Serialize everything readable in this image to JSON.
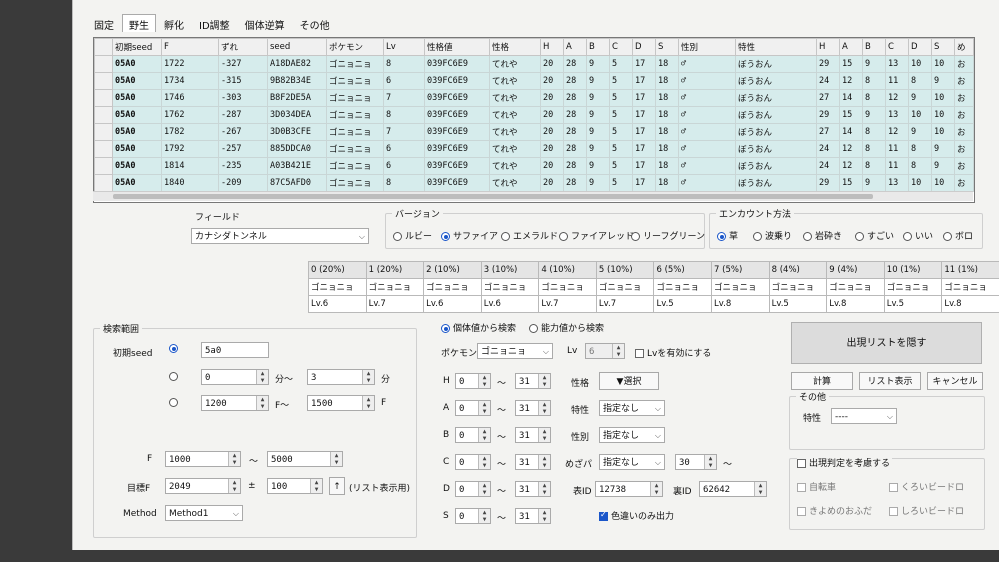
{
  "tabs": [
    "固定",
    "野生",
    "孵化",
    "ID調整",
    "個体逆算",
    "その他"
  ],
  "active_tab": 1,
  "results": {
    "columns": [
      "初期seed",
      "F",
      "ずれ",
      "seed",
      "ポケモン",
      "Lv",
      "性格値",
      "性格",
      "H",
      "A",
      "B",
      "C",
      "D",
      "S",
      "性別",
      "特性",
      "H",
      "A",
      "B",
      "C",
      "D",
      "S",
      "め"
    ],
    "rows": [
      [
        "05A0",
        "1722",
        "-327",
        "A18DAE82",
        "ゴニョニョ",
        "8",
        "039FC6E9",
        "てれや",
        "20",
        "28",
        "9",
        "5",
        "17",
        "18",
        "♂",
        "ぼうおん",
        "29",
        "15",
        "9",
        "13",
        "10",
        "10",
        "お"
      ],
      [
        "05A0",
        "1734",
        "-315",
        "9B82B34E",
        "ゴニョニョ",
        "6",
        "039FC6E9",
        "てれや",
        "20",
        "28",
        "9",
        "5",
        "17",
        "18",
        "♂",
        "ぼうおん",
        "24",
        "12",
        "8",
        "11",
        "8",
        "9",
        "お"
      ],
      [
        "05A0",
        "1746",
        "-303",
        "B8F2DE5A",
        "ゴニョニョ",
        "7",
        "039FC6E9",
        "てれや",
        "20",
        "28",
        "9",
        "5",
        "17",
        "18",
        "♂",
        "ぼうおん",
        "27",
        "14",
        "8",
        "12",
        "9",
        "10",
        "お"
      ],
      [
        "05A0",
        "1762",
        "-287",
        "3D034DEA",
        "ゴニョニョ",
        "8",
        "039FC6E9",
        "てれや",
        "20",
        "28",
        "9",
        "5",
        "17",
        "18",
        "♂",
        "ぼうおん",
        "29",
        "15",
        "9",
        "13",
        "10",
        "10",
        "お"
      ],
      [
        "05A0",
        "1782",
        "-267",
        "3D0B3CFE",
        "ゴニョニョ",
        "7",
        "039FC6E9",
        "てれや",
        "20",
        "28",
        "9",
        "5",
        "17",
        "18",
        "♂",
        "ぼうおん",
        "27",
        "14",
        "8",
        "12",
        "9",
        "10",
        "お"
      ],
      [
        "05A0",
        "1792",
        "-257",
        "885DDCA0",
        "ゴニョニョ",
        "6",
        "039FC6E9",
        "てれや",
        "20",
        "28",
        "9",
        "5",
        "17",
        "18",
        "♂",
        "ぼうおん",
        "24",
        "12",
        "8",
        "11",
        "8",
        "9",
        "お"
      ],
      [
        "05A0",
        "1814",
        "-235",
        "A03B421E",
        "ゴニョニョ",
        "6",
        "039FC6E9",
        "てれや",
        "20",
        "28",
        "9",
        "5",
        "17",
        "18",
        "♂",
        "ぼうおん",
        "24",
        "12",
        "8",
        "11",
        "8",
        "9",
        "お"
      ],
      [
        "05A0",
        "1840",
        "-209",
        "87C5AFD0",
        "ゴニョニョ",
        "8",
        "039FC6E9",
        "てれや",
        "20",
        "28",
        "9",
        "5",
        "17",
        "18",
        "♂",
        "ぼうおん",
        "29",
        "15",
        "9",
        "13",
        "10",
        "10",
        "お"
      ]
    ]
  },
  "field": {
    "legend": "フィールド",
    "value": "カナシダトンネル"
  },
  "version": {
    "legend": "バージョン",
    "options": [
      "ルビー",
      "サファイア",
      "エメラルド",
      "ファイアレッド",
      "リーフグリーン"
    ],
    "selected": 1
  },
  "encounter": {
    "legend": "エンカウント方法",
    "options": [
      "草",
      "波乗り",
      "岩砕き",
      "すごい",
      "いい",
      "ボロ"
    ],
    "selected": 0
  },
  "slots": {
    "headers": [
      "0 (20%)",
      "1 (20%)",
      "2 (10%)",
      "3 (10%)",
      "4 (10%)",
      "5 (10%)",
      "6 (5%)",
      "7 (5%)",
      "8 (4%)",
      "9 (4%)",
      "10 (1%)",
      "11 (1%)"
    ],
    "pokemon": [
      "ゴニョニョ",
      "ゴニョニョ",
      "ゴニョニョ",
      "ゴニョニョ",
      "ゴニョニョ",
      "ゴニョニョ",
      "ゴニョニョ",
      "ゴニョニョ",
      "ゴニョニョ",
      "ゴニョニョ",
      "ゴニョニョ",
      "ゴニョニョ"
    ],
    "levels": [
      "Lv.6",
      "Lv.7",
      "Lv.6",
      "Lv.6",
      "Lv.7",
      "Lv.7",
      "Lv.5",
      "Lv.8",
      "Lv.5",
      "Lv.8",
      "Lv.5",
      "Lv.8"
    ]
  },
  "search_range": {
    "legend": "検索範囲",
    "initial_seed_label": "初期seed",
    "initial_seed": "5a0",
    "min_from": "0",
    "min_to": "3",
    "min_sep": "分～",
    "min_unit": "分",
    "f_from": "1200",
    "f_to": "1500",
    "f_sep": "F～",
    "f_unit": "F",
    "f_label": "F",
    "f_min": "1000",
    "f_max": "5000",
    "tilde": "～",
    "target_label": "目標F",
    "target": "2049",
    "pm": "±",
    "range": "100",
    "up": "↑",
    "list_note": "(リスト表示用)",
    "method_label": "Method",
    "method": "Method1"
  },
  "iv_search": {
    "mode_iv": "個体値から検索",
    "mode_stat": "能力値から検索",
    "pokemon_label": "ポケモン",
    "pokemon": "ゴニョニョ",
    "lv_label": "Lv",
    "lv": "6",
    "lv_enable": "Lvを有効にする",
    "stats": [
      {
        "label": "H",
        "min": "0",
        "max": "31"
      },
      {
        "label": "A",
        "min": "0",
        "max": "31"
      },
      {
        "label": "B",
        "min": "0",
        "max": "31"
      },
      {
        "label": "C",
        "min": "0",
        "max": "31"
      },
      {
        "label": "D",
        "min": "0",
        "max": "31"
      },
      {
        "label": "S",
        "min": "0",
        "max": "31"
      }
    ],
    "nature_label": "性格",
    "nature_btn": "▼選択",
    "ability_label": "特性",
    "ability": "指定なし",
    "gender_label": "性別",
    "gender": "指定なし",
    "hp_label": "めざパ",
    "hp": "指定なし",
    "hp_power": "30",
    "hp_tilde": "～",
    "tid_label": "表ID",
    "tid": "12738",
    "sid_label": "裏ID",
    "sid": "62642",
    "shiny_only": "色違いのみ出力"
  },
  "actions": {
    "hide_list": "出現リストを隠す",
    "calc": "計算",
    "list": "リスト表示",
    "cancel": "キャンセル"
  },
  "other": {
    "legend": "その他",
    "ability_label": "特性",
    "ability": "----"
  },
  "appear": {
    "legend": "出現判定を考慮する",
    "items": [
      "自転車",
      "くろいビードロ",
      "きよめのおふだ",
      "しろいビードロ"
    ]
  }
}
